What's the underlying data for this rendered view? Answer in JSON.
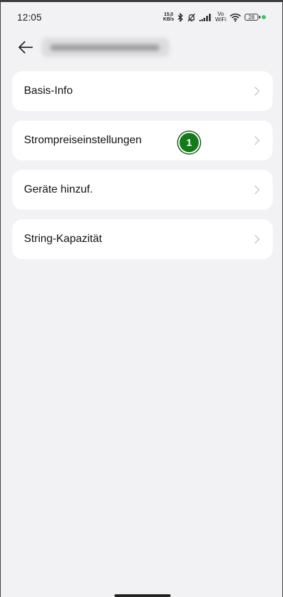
{
  "status": {
    "time": "12:05",
    "net_speed_top": "15,0",
    "net_speed_bottom": "KB/s",
    "vo": "Vo",
    "wifi_label": "WiFi",
    "battery": "28"
  },
  "menu": {
    "items": [
      {
        "label": "Basis-Info"
      },
      {
        "label": "Strompreiseinstellungen"
      },
      {
        "label": "Geräte hinzuf."
      },
      {
        "label": "String-Kapazität"
      }
    ]
  },
  "annotation": {
    "badge": "1"
  }
}
